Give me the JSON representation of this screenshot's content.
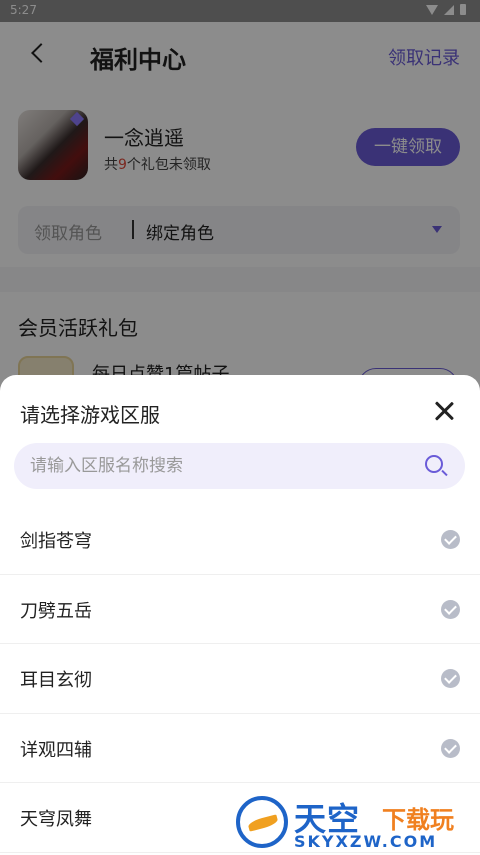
{
  "status_bar": {
    "time": "5:27"
  },
  "header": {
    "title": "福利中心",
    "record_link": "领取记录"
  },
  "game": {
    "name": "一念逍遥",
    "gift_prefix": "共",
    "gift_count": "9",
    "gift_suffix": "个礼包未领取",
    "claim_all": "一键领取"
  },
  "role": {
    "label": "领取角色",
    "bind": "绑定角色"
  },
  "section": {
    "title": "会员活跃礼包",
    "task": "每日点赞1篇帖子"
  },
  "sheet": {
    "title": "请选择游戏区服",
    "search_placeholder": "请输入区服名称搜索",
    "servers": [
      {
        "name": "剑指苍穹"
      },
      {
        "name": "刀劈五岳"
      },
      {
        "name": "耳目玄彻"
      },
      {
        "name": "详观四辅"
      },
      {
        "name": "天穹凤舞"
      }
    ]
  },
  "watermark": {
    "big": "天空",
    "small": "下载玩",
    "url": "SKYXZW.COM"
  },
  "colors": {
    "accent": "#6a5bd8",
    "highlight": "#e0473a",
    "check": "#b8bcc8"
  }
}
